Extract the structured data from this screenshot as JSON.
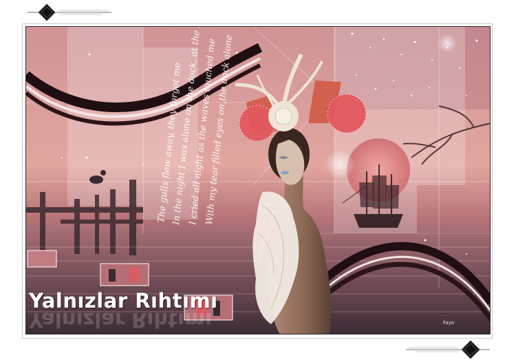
{
  "artwork": {
    "title": "Yalnızlar Rıhtımı",
    "signature": "Fayo",
    "poem_lines": [
      "The gulls flew away, they forgot me",
      "In the night I was alone on the dock, at the sea",
      "I cried all night as the waves touched me",
      "With my tear filled eyes on the dock alone"
    ]
  },
  "colors": {
    "background": "#ffffff",
    "scene_pink": "#d99a96",
    "scene_dark": "#4b3944",
    "ribbon_dark": "#2b1418",
    "ribbon_light": "#f3e7e3",
    "moon": "#e08a8a",
    "fan": "#e2585f"
  },
  "icons": {
    "top_left": "diamond-ornament-icon",
    "bottom_right": "diamond-ornament-icon"
  }
}
